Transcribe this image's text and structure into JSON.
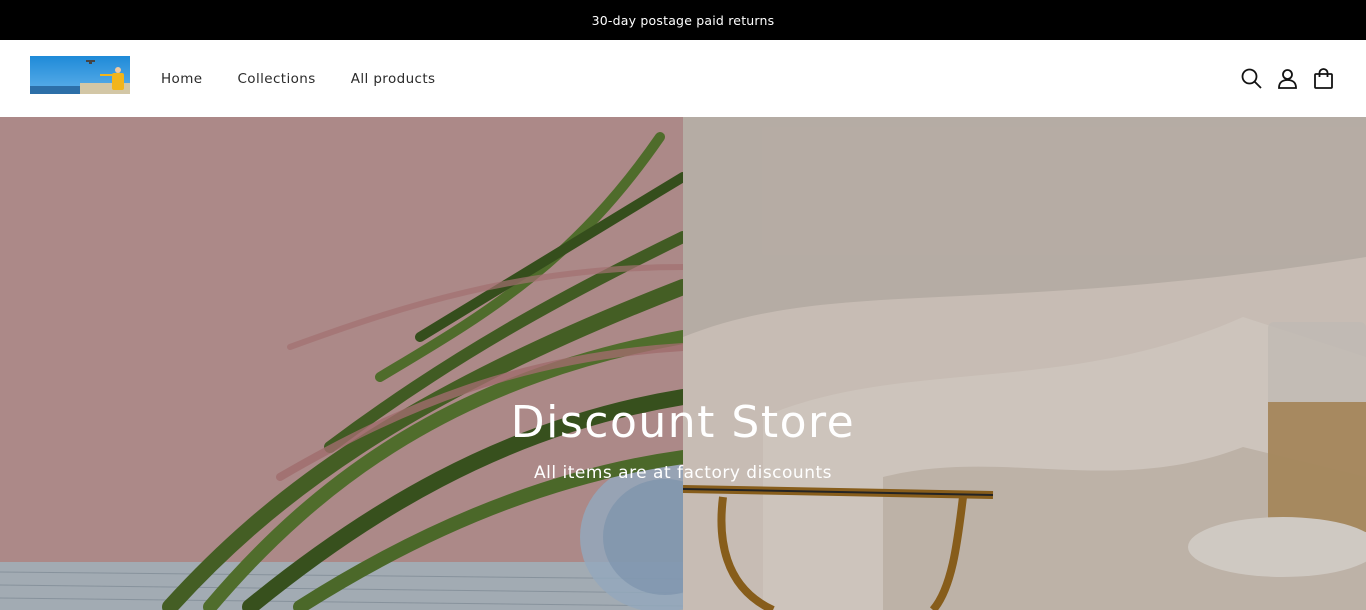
{
  "announcement": {
    "text": "30-day postage paid returns"
  },
  "header": {
    "nav": [
      {
        "label": "Home"
      },
      {
        "label": "Collections"
      },
      {
        "label": "All products"
      }
    ],
    "icons": [
      "search-icon",
      "account-icon",
      "cart-icon"
    ]
  },
  "hero": {
    "title": "Discount Store",
    "subtitle": "All items are at factory discounts"
  },
  "colors": {
    "announcement_bg": "#000000",
    "hero_left_bg": "#c49c9b",
    "hero_right_bg": "#cfc4bb"
  }
}
